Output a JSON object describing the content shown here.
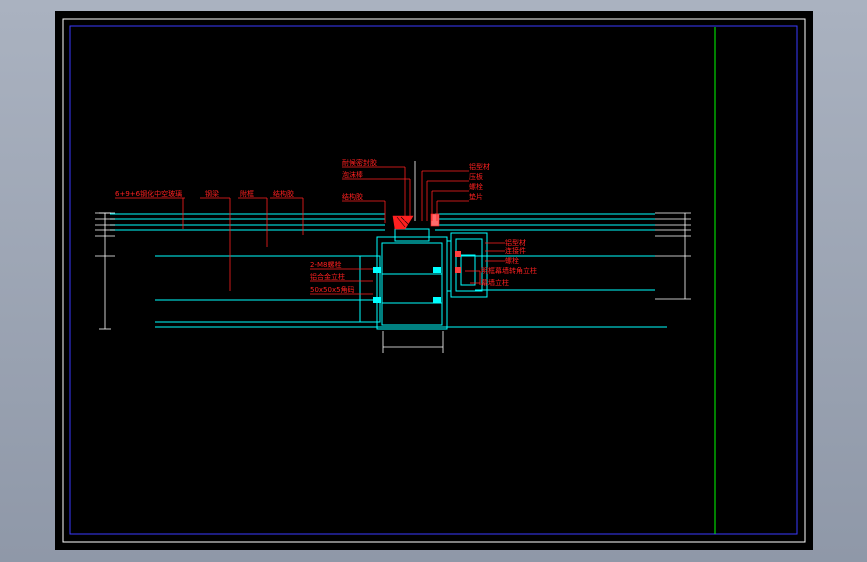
{
  "drawing": {
    "background": "#000000",
    "colors": {
      "frame": "#ffffff",
      "border": "#3a3aff",
      "titleblock_divider": "#00ff00",
      "structure": "#00ffff",
      "annotation": "#ff2020",
      "hatch": "#ff2020",
      "dimension": "#ffffff"
    },
    "callouts_left": [
      "6+9+6钢化中空玻璃",
      "钢梁",
      "附框",
      "结构胶"
    ],
    "callouts_top": [
      "结构胶",
      "耐候密封胶",
      "泡沫棒"
    ],
    "callouts_top_right": [
      "铝型材",
      "压板",
      "螺栓",
      "垫片"
    ],
    "callouts_right": [
      "铝型材",
      "连接件",
      "螺栓",
      "明框幕墙转角立柱",
      "幕墙立柱"
    ],
    "callouts_middle": [
      "2-M8螺栓",
      "铝合金立柱",
      "50x50x5角码"
    ]
  }
}
